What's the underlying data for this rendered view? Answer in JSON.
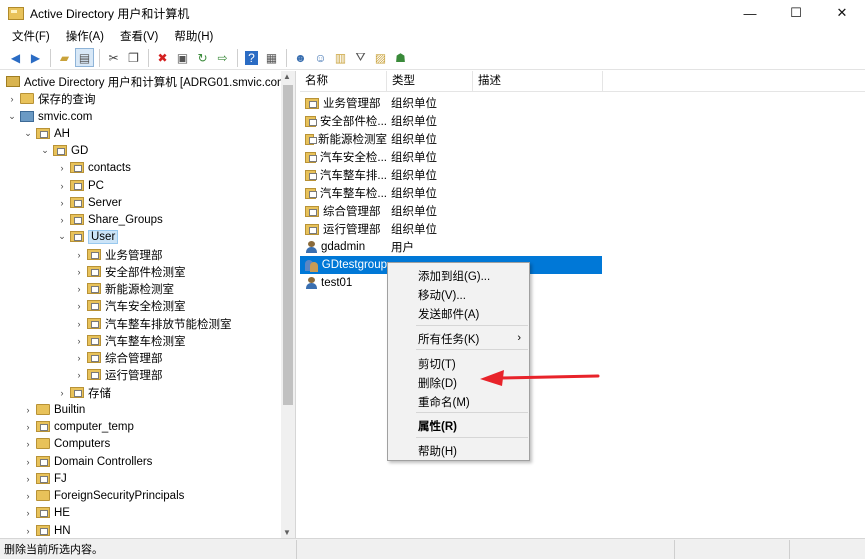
{
  "window": {
    "title": "Active Directory 用户和计算机",
    "minimize": "—",
    "maximize": "☐",
    "close": "✕"
  },
  "menu": [
    "文件(F)",
    "操作(A)",
    "查看(V)",
    "帮助(H)"
  ],
  "toolbar": [
    "back-icon",
    "forward-icon",
    "up-folder-icon",
    "show-tree-icon",
    "cut-icon",
    "copy-icon",
    "delete-icon",
    "properties-icon",
    "refresh-icon",
    "export-icon",
    "help-icon",
    "console-icon",
    "new-user-icon",
    "new-group-icon",
    "new-ou-icon",
    "filter-icon",
    "find-icon",
    "add-to-group-icon"
  ],
  "tree": {
    "root": "Active Directory 用户和计算机 [ADRG01.smvic.com]",
    "saved_queries": "保存的查询",
    "domain": "smvic.com",
    "ah": "AH",
    "gd": "GD",
    "gd_children": [
      "contacts",
      "PC",
      "Server",
      "Share_Groups"
    ],
    "user": "User",
    "user_children": [
      "业务管理部",
      "安全部件检测室",
      "新能源检测室",
      "汽车安全检测室",
      "汽车整车排放节能检测室",
      "汽车整车检测室",
      "综合管理部",
      "运行管理部"
    ],
    "storage": "存储",
    "top_level": [
      "Builtin",
      "computer_temp",
      "Computers",
      "Domain Controllers",
      "FJ",
      "ForeignSecurityPrincipals",
      "HE",
      "HN"
    ]
  },
  "list": {
    "columns": [
      "名称",
      "类型",
      "描述"
    ],
    "rows": [
      {
        "name": "业务管理部",
        "type": "组织单位",
        "icon": "ou-icon"
      },
      {
        "name": "安全部件检...",
        "type": "组织单位",
        "icon": "ou-icon"
      },
      {
        "name": "新能源检测室",
        "type": "组织单位",
        "icon": "ou-icon"
      },
      {
        "name": "汽车安全检...",
        "type": "组织单位",
        "icon": "ou-icon"
      },
      {
        "name": "汽车整车排...",
        "type": "组织单位",
        "icon": "ou-icon"
      },
      {
        "name": "汽车整车检...",
        "type": "组织单位",
        "icon": "ou-icon"
      },
      {
        "name": "综合管理部",
        "type": "组织单位",
        "icon": "ou-icon"
      },
      {
        "name": "运行管理部",
        "type": "组织单位",
        "icon": "ou-icon"
      },
      {
        "name": "gdadmin",
        "type": "用户",
        "icon": "user-icon"
      },
      {
        "name": "GDtestgroup",
        "type": "",
        "icon": "group-icon"
      },
      {
        "name": "test01",
        "type": "",
        "icon": "user-icon"
      }
    ]
  },
  "context_menu": {
    "items": [
      "添加到组(G)...",
      "移动(V)...",
      "发送邮件(A)",
      "所有任务(K)",
      "剪切(T)",
      "删除(D)",
      "重命名(M)",
      "属性(R)",
      "帮助(H)"
    ],
    "submenu_arrow": "›"
  },
  "status": "删除当前所选内容。",
  "colors": {
    "selection": "#0078d7",
    "arrow": "#e8232a",
    "folder": "#e8c25a"
  }
}
